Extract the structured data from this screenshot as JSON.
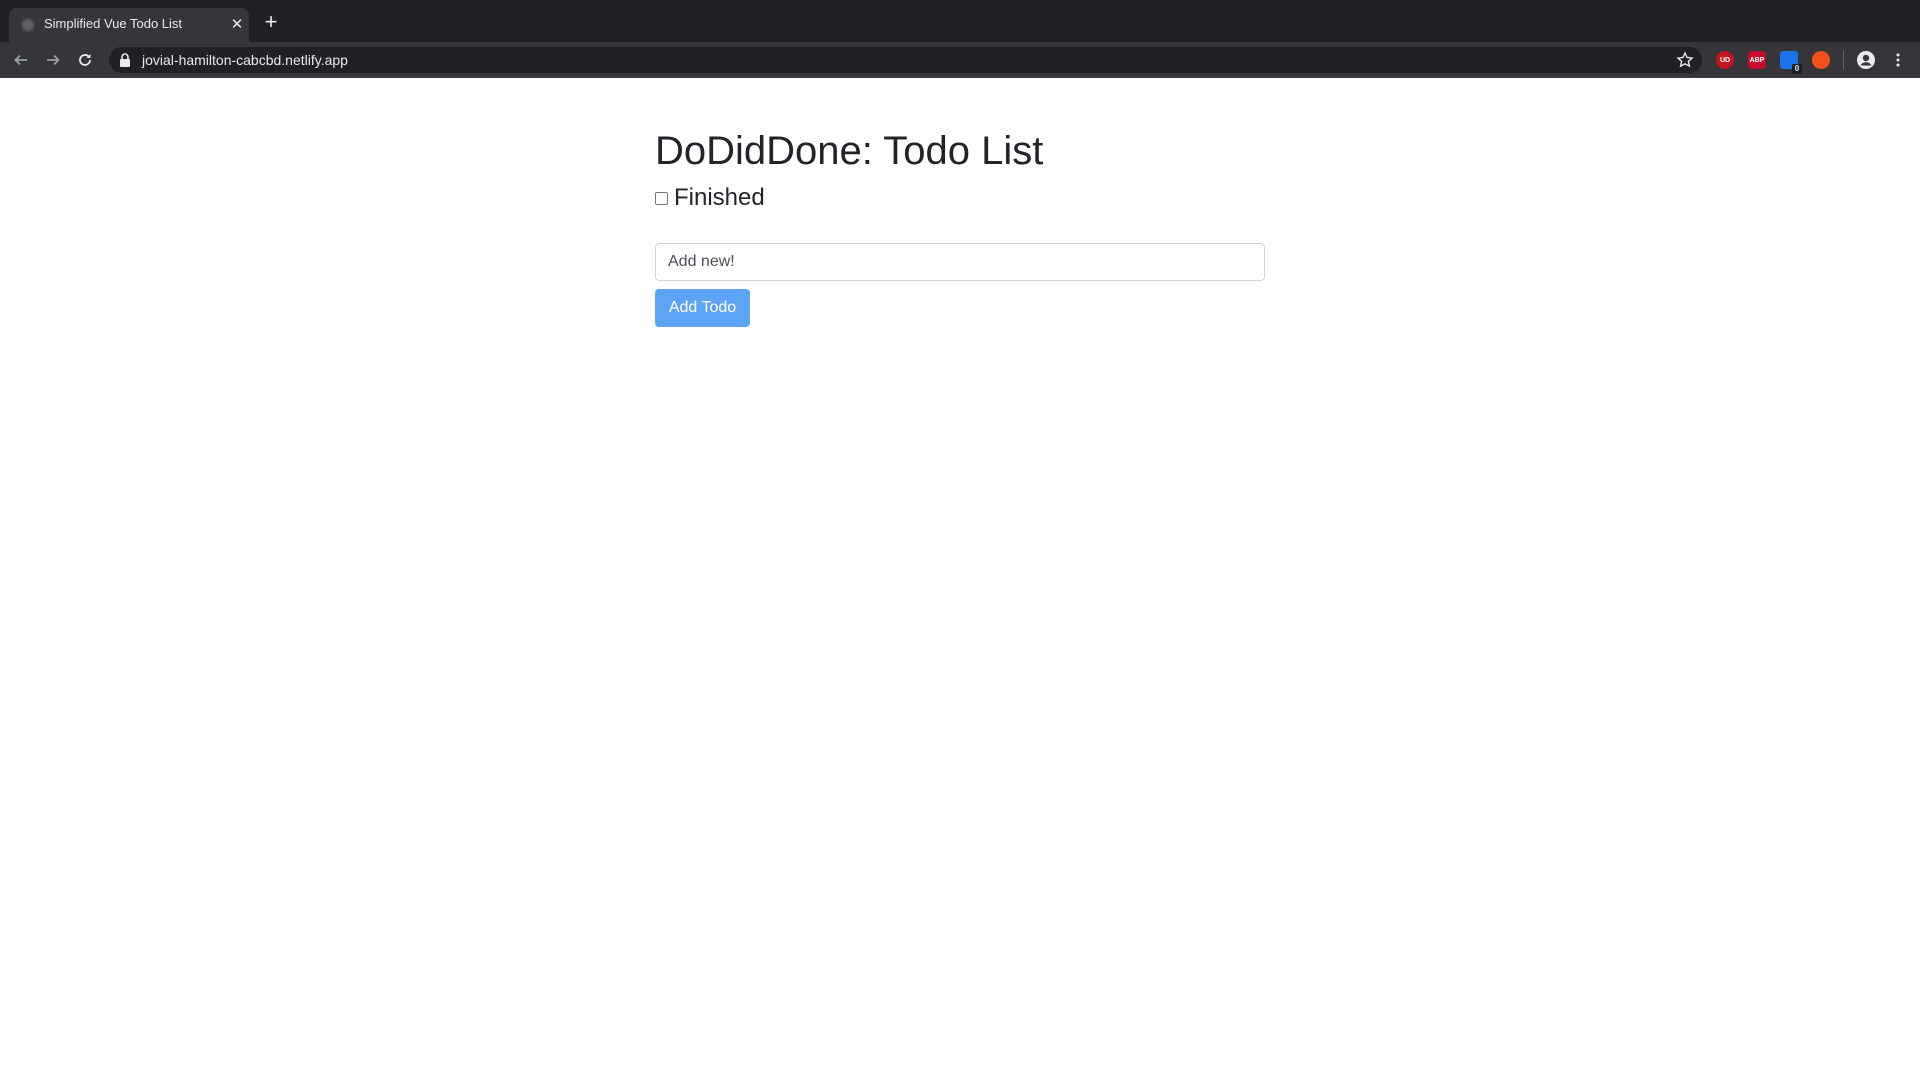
{
  "browser": {
    "tab": {
      "title": "Simplified Vue Todo List",
      "close_glyph": "✕"
    },
    "new_tab_glyph": "+",
    "address_bar": {
      "url": "jovial-hamilton-cabcbd.netlify.app"
    },
    "extensions": [
      {
        "icon": "ublock-origin-icon",
        "label": "UD",
        "color": "#c4141d"
      },
      {
        "icon": "adblock-plus-icon",
        "label": "ABP",
        "color": "#c70d2c"
      },
      {
        "icon": "extension-blue-icon",
        "label": "",
        "color": "#1a73e8",
        "badge": "0"
      },
      {
        "icon": "extension-orange-icon",
        "label": "",
        "color": "#f4511e"
      }
    ]
  },
  "app": {
    "title": "DoDidDone: Todo List",
    "filter": {
      "label": "Finished",
      "checked": false
    },
    "new_todo": {
      "placeholder": "Add new!",
      "value": ""
    },
    "add_button_label": "Add Todo",
    "accent_color": "#5da4f7"
  }
}
